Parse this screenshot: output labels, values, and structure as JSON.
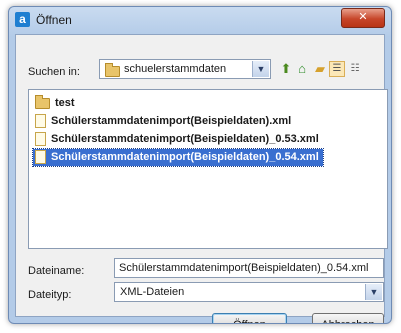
{
  "window": {
    "title": "Öffnen",
    "app_icon": "a",
    "close_label": "✕"
  },
  "look_in": {
    "label": "Suchen in:",
    "value": "schuelerstammdaten"
  },
  "toolbar": {
    "up_icon": "folder-up-icon",
    "home_icon": "home-icon",
    "new_folder_icon": "new-folder-icon",
    "list_view_icon": "list-view-icon",
    "details_view_icon": "details-view-icon"
  },
  "files": [
    {
      "name": "test",
      "type": "folder",
      "selected": false
    },
    {
      "name": "Schülerstammdatenimport(Beispieldaten).xml",
      "type": "file",
      "selected": false
    },
    {
      "name": "Schülerstammdatenimport(Beispieldaten)_0.53.xml",
      "type": "file",
      "selected": false
    },
    {
      "name": "Schülerstammdatenimport(Beispieldaten)_0.54.xml",
      "type": "file",
      "selected": true
    }
  ],
  "filename": {
    "label": "Dateiname:",
    "value": "Schülerstammdatenimport(Beispieldaten)_0.54.xml"
  },
  "filetype": {
    "label": "Dateityp:",
    "value": "XML-Dateien"
  },
  "buttons": {
    "open": "Öffnen",
    "cancel": "Abbrechen"
  },
  "colors": {
    "selection": "#3a6fd0",
    "titlebar": "#b3cbe8",
    "close": "#c7462a"
  }
}
